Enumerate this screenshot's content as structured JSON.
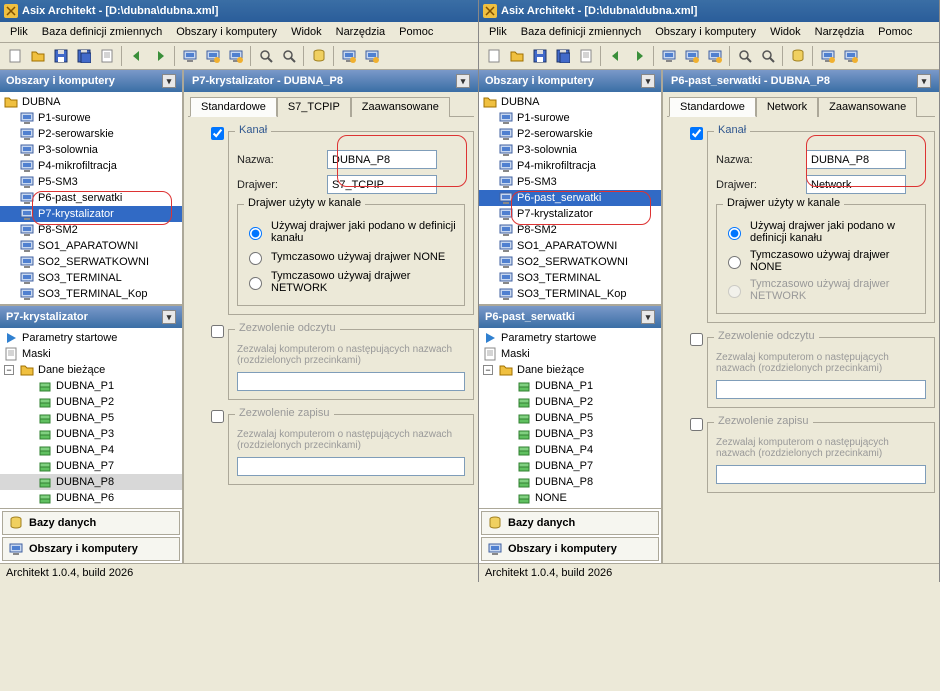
{
  "title": "Asix Architekt - [D:\\dubna\\dubna.xml]",
  "menu": {
    "plik": "Plik",
    "baza": "Baza definicji zmiennych",
    "obszary": "Obszary i komputery",
    "widok": "Widok",
    "narzedzia": "Narzędzia",
    "pomoc": "Pomoc"
  },
  "side_title": "Obszary i komputery",
  "tree": {
    "root": "DUBNA",
    "items": [
      "P1-surowe",
      "P2-serowarskie",
      "P3-solownia",
      "P4-mikrofiltracja",
      "P5-SM3",
      "P6-past_serwatki",
      "P7-krystalizator",
      "P8-SM2",
      "SO1_APARATOWNI",
      "SO2_SERWATKOWNI",
      "SO3_TERMINAL",
      "SO3_TERMINAL_Kop"
    ]
  },
  "left": {
    "selected": "P7-krystalizator",
    "panel2_title": "P7-krystalizator",
    "panel2_items": {
      "start": "Parametry startowe",
      "maski": "Maski",
      "dane": "Dane bieżące"
    },
    "dane_items": [
      "DUBNA_P1",
      "DUBNA_P2",
      "DUBNA_P5",
      "DUBNA_P3",
      "DUBNA_P4",
      "DUBNA_P7",
      "DUBNA_P8",
      "DUBNA_P6"
    ],
    "main_title": "P7-krystalizator - DUBNA_P8",
    "tabs": [
      "Standardowe",
      "S7_TCPIP",
      "Zaawansowane"
    ],
    "form": {
      "kanal": "Kanał",
      "nazwa_lbl": "Nazwa:",
      "nazwa_val": "DUBNA_P8",
      "drajwer_lbl": "Drajwer:",
      "drajwer_val": "S7_TCPIP",
      "inner_lbl": "Drajwer użyty w kanale",
      "r1": "Używaj drajwer jaki podano w definicji kanału",
      "r2": "Tymczasowo używaj drajwer NONE",
      "r3": "Tymczasowo używaj drajwer NETWORK",
      "zod": "Zezwolenie odczytu",
      "zod_hint": "Zezwalaj komputerom o następujących nazwach (rozdzielonych przecinkami)",
      "zza": "Zezwolenie zapisu",
      "zza_hint": "Zezwalaj komputerom o następujących nazwach (rozdzielonych przecinkami)"
    }
  },
  "right": {
    "selected": "P6-past_serwatki",
    "panel2_title": "P6-past_serwatki",
    "panel2_items": {
      "start": "Parametry startowe",
      "maski": "Maski",
      "dane": "Dane bieżące"
    },
    "dane_items": [
      "DUBNA_P1",
      "DUBNA_P2",
      "DUBNA_P5",
      "DUBNA_P3",
      "DUBNA_P4",
      "DUBNA_P7",
      "DUBNA_P8",
      "NONE"
    ],
    "main_title": "P6-past_serwatki - DUBNA_P8",
    "tabs": [
      "Standardowe",
      "Network",
      "Zaawansowane"
    ],
    "form": {
      "kanal": "Kanał",
      "nazwa_lbl": "Nazwa:",
      "nazwa_val": "DUBNA_P8",
      "drajwer_lbl": "Drajwer:",
      "drajwer_val": "Network",
      "inner_lbl": "Drajwer użyty w kanale",
      "r1": "Używaj drajwer jaki podano w definicji kanału",
      "r2": "Tymczasowo używaj drajwer NONE",
      "r3": "Tymczasowo używaj drajwer NETWORK",
      "zod": "Zezwolenie odczytu",
      "zod_hint": "Zezwalaj komputerom o następujących nazwach (rozdzielonych przecinkami)",
      "zza": "Zezwolenie zapisu",
      "zza_hint": "Zezwalaj komputerom o następujących nazwach (rozdzielonych przecinkami)"
    }
  },
  "footer": {
    "bazy": "Bazy danych",
    "obszary": "Obszary i komputery"
  },
  "status": "Architekt 1.0.4, build 2026"
}
